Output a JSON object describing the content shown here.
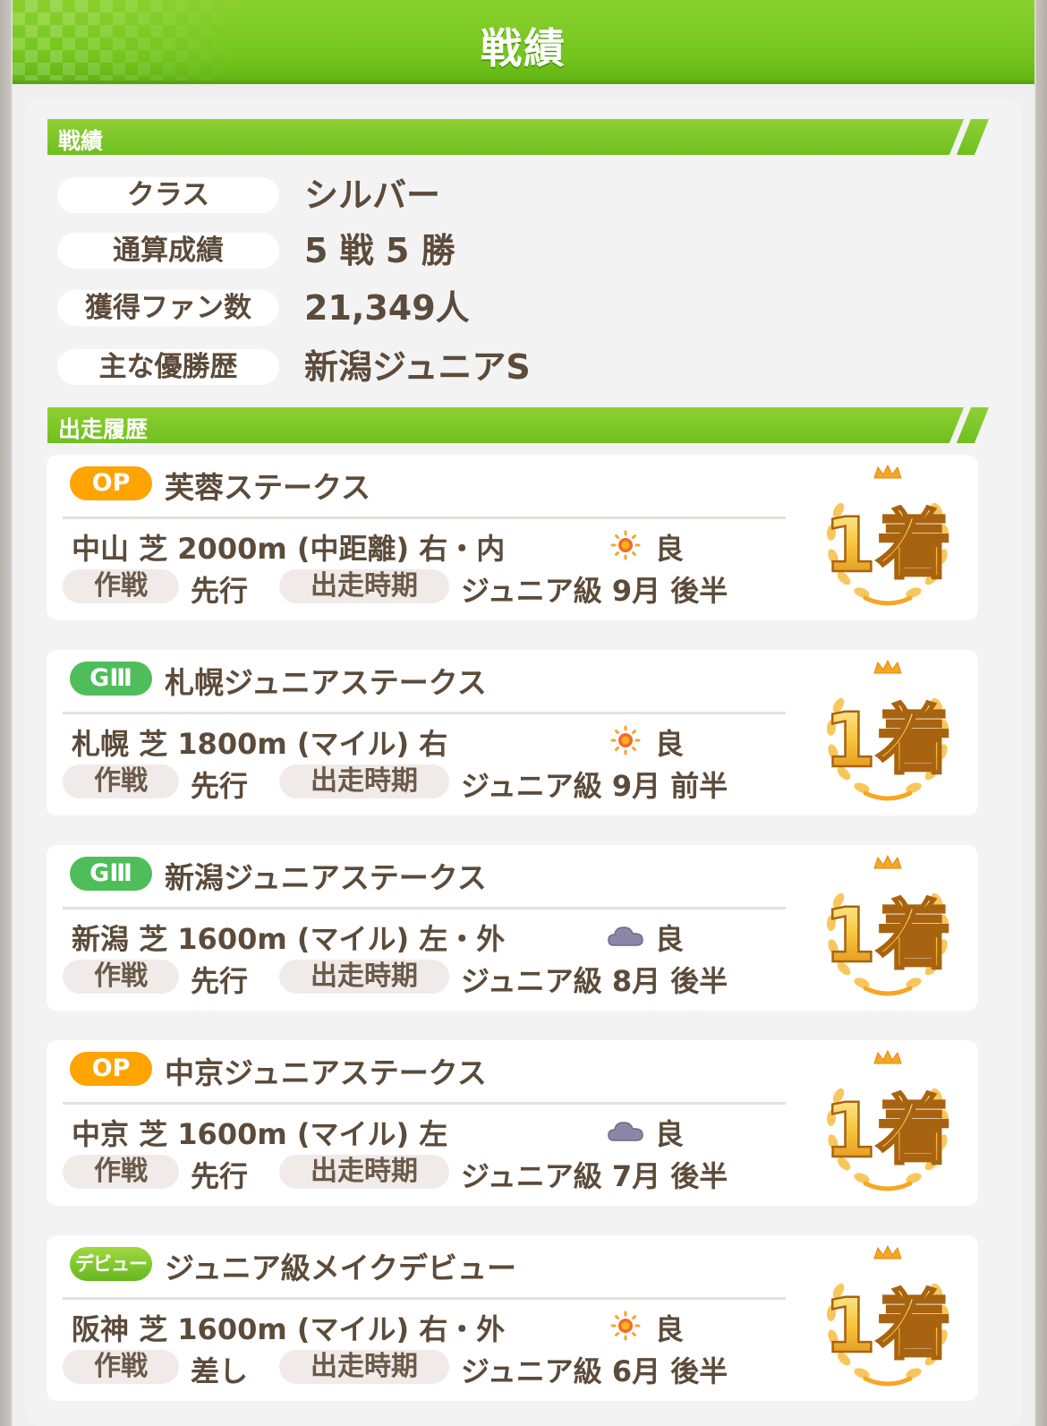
{
  "header": {
    "title": "戦績"
  },
  "record_section": {
    "label": "戦績",
    "rows": [
      {
        "key": "クラス",
        "value": "シルバー"
      },
      {
        "key": "通算成績",
        "value": "5 戦 5 勝"
      },
      {
        "key": "獲得ファン数",
        "value": "21,349人"
      },
      {
        "key": "主な優勝歴",
        "value": "新潟ジュニアS"
      }
    ]
  },
  "history_section": {
    "label": "出走履歴",
    "tactic_label": "作戦",
    "period_label": "出走時期",
    "races": [
      {
        "grade": "OP",
        "grade_color": "#ffa400",
        "name": "芙蓉ステークス",
        "course": "中山 芝 2000m (中距離) 右・内",
        "weather_icon": "sun-icon",
        "ground": "良",
        "tactic": "先行",
        "period": "ジュニア級 9月 後半",
        "result": "1着"
      },
      {
        "grade": "GⅢ",
        "grade_color": "#4fbe5a",
        "name": "札幌ジュニアステークス",
        "course": "札幌 芝 1800m (マイル) 右",
        "weather_icon": "sun-icon",
        "ground": "良",
        "tactic": "先行",
        "period": "ジュニア級 9月 前半",
        "result": "1着"
      },
      {
        "grade": "GⅢ",
        "grade_color": "#4fbe5a",
        "name": "新潟ジュニアステークス",
        "course": "新潟 芝 1600m (マイル) 左・外",
        "weather_icon": "cloud-icon",
        "ground": "良",
        "tactic": "先行",
        "period": "ジュニア級 8月 後半",
        "result": "1着"
      },
      {
        "grade": "OP",
        "grade_color": "#ffa400",
        "name": "中京ジュニアステークス",
        "course": "中京 芝 1600m (マイル) 左",
        "weather_icon": "cloud-icon",
        "ground": "良",
        "tactic": "先行",
        "period": "ジュニア級 7月 後半",
        "result": "1着"
      },
      {
        "grade": "デビュー",
        "grade_color": "#7cc62a",
        "name": "ジュニア級メイクデビュー",
        "course": "阪神 芝 1600m (マイル) 右・外",
        "weather_icon": "sun-icon",
        "ground": "良",
        "tactic": "差し",
        "period": "ジュニア級 6月 後半",
        "result": "1着"
      }
    ]
  }
}
